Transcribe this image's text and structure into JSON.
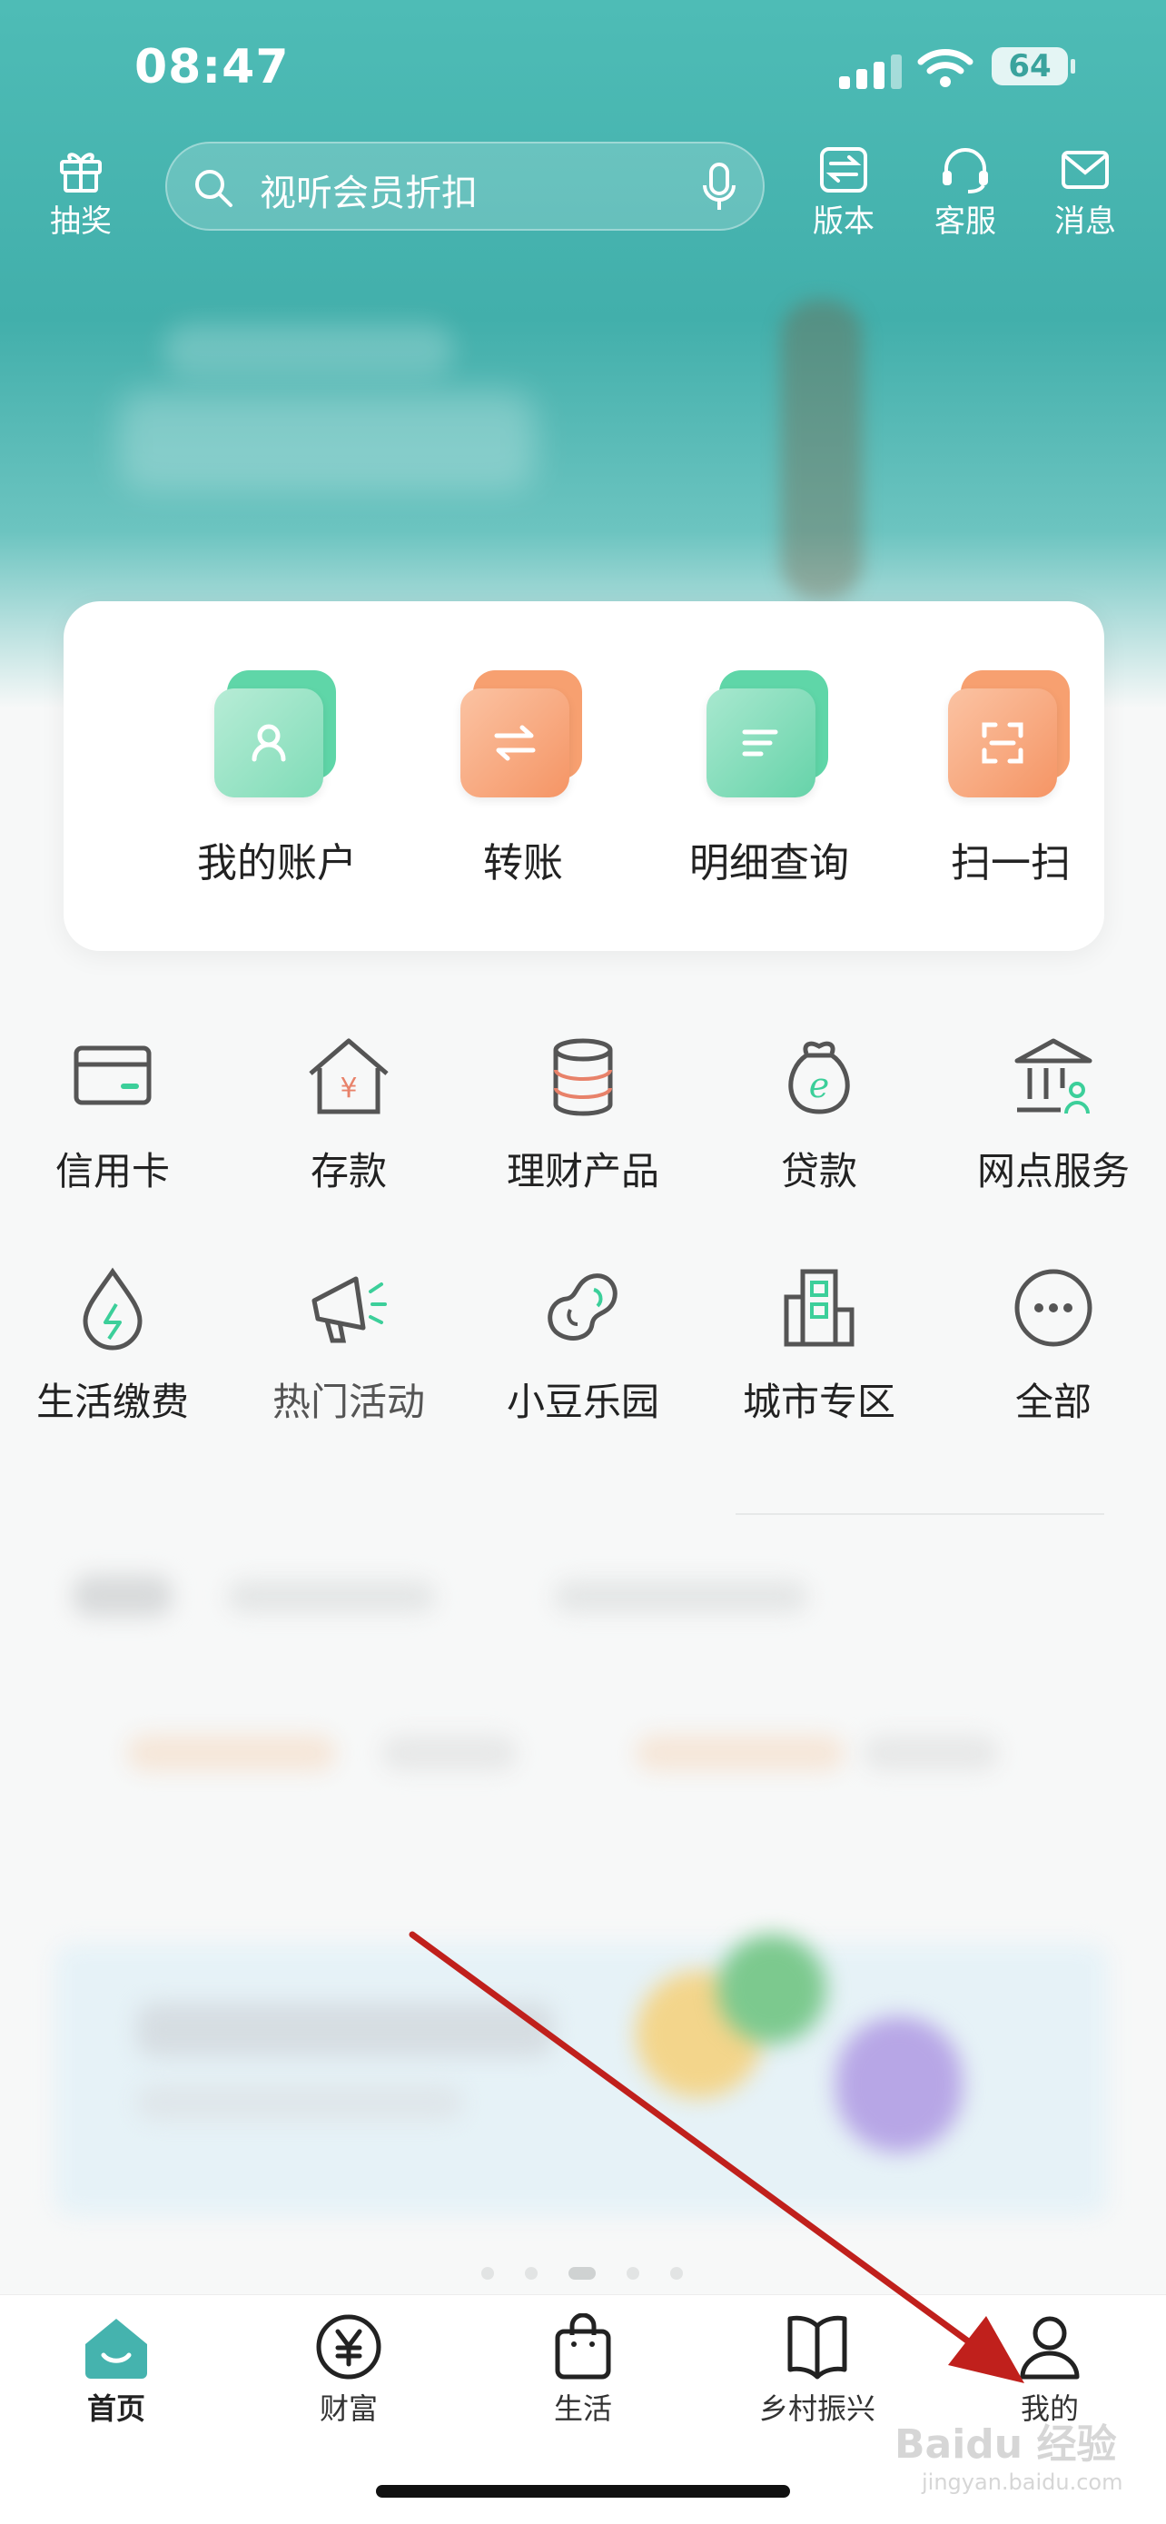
{
  "status_bar": {
    "time": "08:47",
    "battery": "64"
  },
  "top_bar": {
    "left_button": {
      "label": "抽奖",
      "icon": "gift-icon"
    },
    "search": {
      "placeholder": "视听会员折扣"
    },
    "right_buttons": [
      {
        "label": "版本",
        "icon": "version-switch-icon"
      },
      {
        "label": "客服",
        "icon": "headset-icon"
      },
      {
        "label": "消息",
        "icon": "mail-icon"
      }
    ]
  },
  "quick_actions": [
    {
      "label": "我的账户",
      "icon": "account-icon",
      "color": "#3ccf9a"
    },
    {
      "label": "转账",
      "icon": "transfer-icon",
      "color": "#f58a52"
    },
    {
      "label": "明细查询",
      "icon": "detail-list-icon",
      "color": "#3ccf9a"
    },
    {
      "label": "扫一扫",
      "icon": "scan-icon",
      "color": "#f58a52"
    }
  ],
  "services": [
    {
      "label": "信用卡",
      "icon": "credit-card-icon"
    },
    {
      "label": "存款",
      "icon": "deposit-icon"
    },
    {
      "label": "理财产品",
      "icon": "wealth-product-icon"
    },
    {
      "label": "贷款",
      "icon": "loan-bag-icon"
    },
    {
      "label": "网点服务",
      "icon": "branch-bank-icon"
    },
    {
      "label": "生活缴费",
      "icon": "utility-drop-icon"
    },
    {
      "label": "热门活动",
      "icon": "megaphone-icon"
    },
    {
      "label": "小豆乐园",
      "icon": "bean-icon"
    },
    {
      "label": "城市专区",
      "icon": "city-building-icon"
    },
    {
      "label": "全部",
      "icon": "more-icon"
    }
  ],
  "carousel": {
    "page_count": 5,
    "active_index": 2
  },
  "tab_bar": [
    {
      "label": "首页",
      "icon": "home-icon",
      "active": true
    },
    {
      "label": "财富",
      "icon": "yuan-icon",
      "active": false
    },
    {
      "label": "生活",
      "icon": "shopping-bag-icon",
      "active": false
    },
    {
      "label": "乡村振兴",
      "icon": "book-icon",
      "active": false
    },
    {
      "label": "我的",
      "icon": "user-icon",
      "active": false
    }
  ],
  "annotation": {
    "color": "#c0201c"
  },
  "watermark": {
    "text": "Baidu 经验",
    "sub": "jingyan.baidu.com"
  },
  "colors": {
    "brand_teal": "#45b3ae",
    "brand_green": "#3ccf9a",
    "accent_orange": "#f58a52"
  }
}
